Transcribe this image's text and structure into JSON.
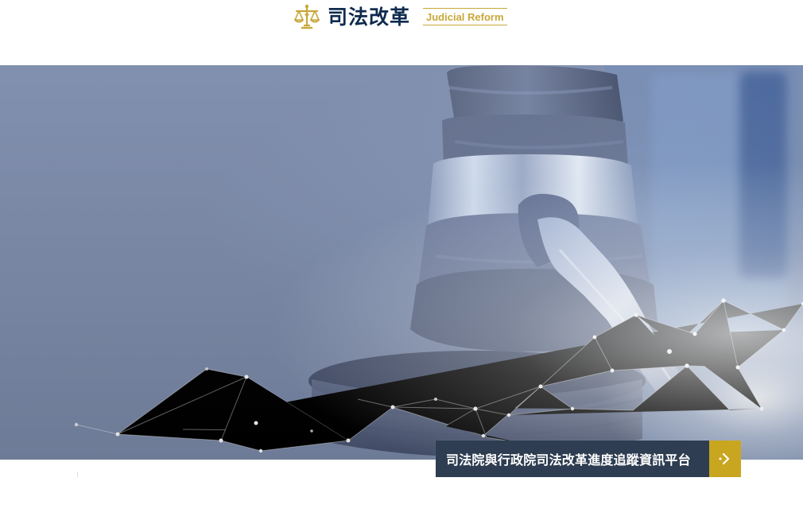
{
  "header": {
    "title_cn": "司法改革",
    "title_en": "Judicial Reform",
    "logo_icon": "scales-of-justice-icon"
  },
  "hero": {
    "image_subject": "gavel",
    "overlay_style": "connected network nodes"
  },
  "cta": {
    "label": "司法院與行政院司法改革進度追蹤資訊平台",
    "icon": "chevron-right-icon"
  },
  "colors": {
    "brand_gold": "#c9a83b",
    "title_navy": "#0f2b4e",
    "cta_dark": "#2e3d51",
    "cta_gold": "#c9a61f",
    "hero_blue": "#7b8aab"
  }
}
